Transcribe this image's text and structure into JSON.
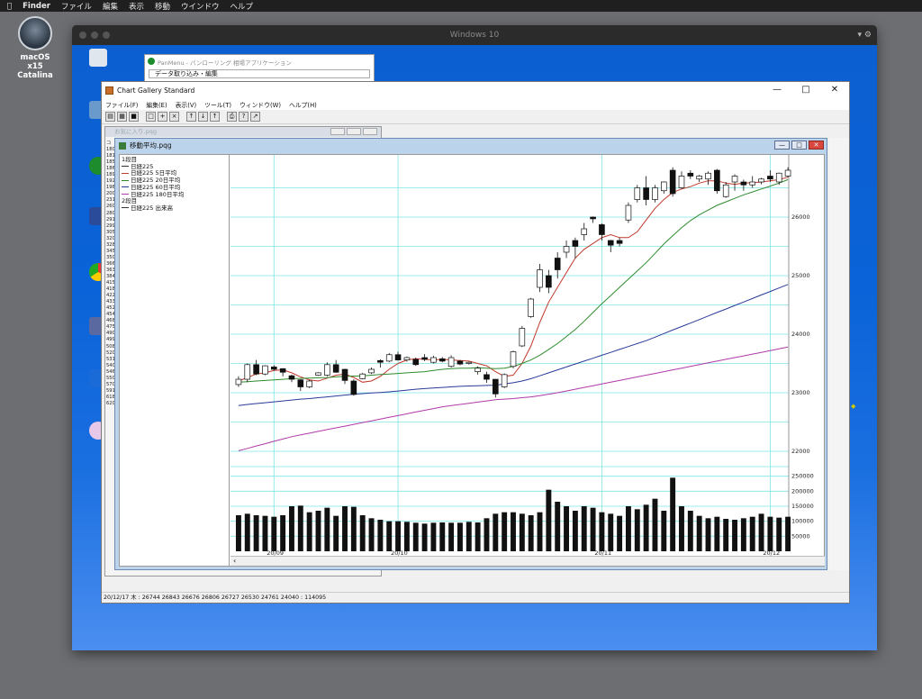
{
  "menubar": {
    "apple": "",
    "items": [
      "Finder",
      "ファイル",
      "編集",
      "表示",
      "移動",
      "ウインドウ",
      "ヘルプ"
    ]
  },
  "mac_desktop": {
    "disk_label_1": "macOS x15",
    "disk_label_2": "Catalina"
  },
  "vm": {
    "title": "Windows 10"
  },
  "panmenu": {
    "title": "PanMenu - パンローリング 相場アプリケーション",
    "row": "データ取り込み・編集"
  },
  "app": {
    "title": "Chart Gallery Standard",
    "menu": [
      "ファイル(F)",
      "編集(E)",
      "表示(V)",
      "ツール(T)",
      "ウィンドウ(W)",
      "ヘルプ(H)"
    ],
    "status": "20/12/17 木 : 26744 26843 26676 26806   26727 26530 24761 24040 : 114095"
  },
  "fav": {
    "title": "お気に入り.pqg",
    "codes": [
      "コ",
      "180",
      "181",
      "185",
      "186",
      "189",
      "192",
      "198",
      "200",
      "231",
      "260",
      "280",
      "291",
      "299",
      "305",
      "320",
      "328",
      "345",
      "350",
      "366",
      "363",
      "384",
      "415",
      "418",
      "422",
      "433",
      "452",
      "454",
      "468",
      "475",
      "490",
      "499",
      "508",
      "520",
      "531",
      "540",
      "546",
      "550",
      "570",
      "591",
      "618",
      "620"
    ]
  },
  "chartwin": {
    "title": "移動平均.pqg"
  },
  "legend": {
    "pane1": "1段目",
    "items": [
      {
        "label": "日経225",
        "color": "#333333"
      },
      {
        "label": "日経225 5日平均",
        "color": "#c0392b"
      },
      {
        "label": "日経225 20日平均",
        "color": "#2e8b2e"
      },
      {
        "label": "日経225 60日平均",
        "color": "#2a3a9a"
      },
      {
        "label": "日経225 180日平均",
        "color": "#b03aa8"
      }
    ],
    "pane2": "2段目",
    "volume_item": {
      "label": "日経225 出来高",
      "color": "#333333"
    }
  },
  "chart_data": {
    "type": "candlestick",
    "price_axis_ticks": [
      22000,
      23000,
      24000,
      25000,
      26000
    ],
    "volume_axis_ticks": [
      50000,
      100000,
      150000,
      200000,
      250000
    ],
    "x_tick_labels": [
      "20/09",
      "20/10",
      "20/11",
      "20/12"
    ],
    "candles": [
      {
        "o": 23140,
        "c": 23230,
        "h": 23280,
        "l": 23100
      },
      {
        "o": 23230,
        "c": 23480,
        "h": 23500,
        "l": 23180
      },
      {
        "o": 23480,
        "c": 23320,
        "h": 23560,
        "l": 23300
      },
      {
        "o": 23320,
        "c": 23460,
        "h": 23470,
        "l": 23300
      },
      {
        "o": 23440,
        "c": 23400,
        "h": 23470,
        "l": 23380
      },
      {
        "o": 23410,
        "c": 23350,
        "h": 23420,
        "l": 23280
      },
      {
        "o": 23290,
        "c": 23230,
        "h": 23310,
        "l": 23180
      },
      {
        "o": 23220,
        "c": 23100,
        "h": 23230,
        "l": 23030
      },
      {
        "o": 23100,
        "c": 23200,
        "h": 23220,
        "l": 23080
      },
      {
        "o": 23300,
        "c": 23340,
        "h": 23350,
        "l": 23290
      },
      {
        "o": 23300,
        "c": 23480,
        "h": 23520,
        "l": 23280
      },
      {
        "o": 23480,
        "c": 23350,
        "h": 23560,
        "l": 23340
      },
      {
        "o": 23400,
        "c": 23210,
        "h": 23410,
        "l": 23150
      },
      {
        "o": 23200,
        "c": 22970,
        "h": 23230,
        "l": 22950
      },
      {
        "o": 23240,
        "c": 23320,
        "h": 23340,
        "l": 23230
      },
      {
        "o": 23340,
        "c": 23400,
        "h": 23430,
        "l": 23320
      },
      {
        "o": 23550,
        "c": 23520,
        "h": 23570,
        "l": 23430
      },
      {
        "o": 23540,
        "c": 23650,
        "h": 23680,
        "l": 23520
      },
      {
        "o": 23650,
        "c": 23560,
        "h": 23700,
        "l": 23550
      },
      {
        "o": 23560,
        "c": 23600,
        "h": 23620,
        "l": 23530
      },
      {
        "o": 23570,
        "c": 23480,
        "h": 23600,
        "l": 23460
      },
      {
        "o": 23600,
        "c": 23570,
        "h": 23660,
        "l": 23540
      },
      {
        "o": 23520,
        "c": 23600,
        "h": 23630,
        "l": 23500
      },
      {
        "o": 23580,
        "c": 23540,
        "h": 23610,
        "l": 23520
      },
      {
        "o": 23450,
        "c": 23600,
        "h": 23640,
        "l": 23430
      },
      {
        "o": 23540,
        "c": 23490,
        "h": 23560,
        "l": 23470
      },
      {
        "o": 23500,
        "c": 23520,
        "h": 23530,
        "l": 23480
      },
      {
        "o": 23360,
        "c": 23420,
        "h": 23450,
        "l": 23310
      },
      {
        "o": 23310,
        "c": 23230,
        "h": 23360,
        "l": 23170
      },
      {
        "o": 23230,
        "c": 22980,
        "h": 23230,
        "l": 22920
      },
      {
        "o": 23100,
        "c": 23310,
        "h": 23330,
        "l": 23080
      },
      {
        "o": 23450,
        "c": 23700,
        "h": 23720,
        "l": 23420
      },
      {
        "o": 23800,
        "c": 24100,
        "h": 24140,
        "l": 23780
      },
      {
        "o": 24300,
        "c": 24600,
        "h": 24620,
        "l": 24280
      },
      {
        "o": 24800,
        "c": 25100,
        "h": 25200,
        "l": 24720
      },
      {
        "o": 25000,
        "c": 24800,
        "h": 25100,
        "l": 24700
      },
      {
        "o": 25300,
        "c": 25100,
        "h": 25400,
        "l": 24950
      },
      {
        "o": 25400,
        "c": 25500,
        "h": 25600,
        "l": 25300
      },
      {
        "o": 25600,
        "c": 25500,
        "h": 25650,
        "l": 25300
      },
      {
        "o": 25700,
        "c": 25800,
        "h": 25900,
        "l": 25600
      },
      {
        "o": 26000,
        "c": 25970,
        "h": 26010,
        "l": 25900
      },
      {
        "o": 25870,
        "c": 25700,
        "h": 25890,
        "l": 25600
      },
      {
        "o": 25600,
        "c": 25520,
        "h": 25610,
        "l": 25400
      },
      {
        "o": 25600,
        "c": 25550,
        "h": 25650,
        "l": 25500
      },
      {
        "o": 25950,
        "c": 26200,
        "h": 26250,
        "l": 25900
      },
      {
        "o": 26300,
        "c": 26500,
        "h": 26550,
        "l": 26250
      },
      {
        "o": 26500,
        "c": 26300,
        "h": 26700,
        "l": 26200
      },
      {
        "o": 26300,
        "c": 26500,
        "h": 26550,
        "l": 26250
      },
      {
        "o": 26450,
        "c": 26600,
        "h": 26610,
        "l": 26400
      },
      {
        "o": 26800,
        "c": 26400,
        "h": 26850,
        "l": 26350
      },
      {
        "o": 26500,
        "c": 26700,
        "h": 26780,
        "l": 26480
      },
      {
        "o": 26750,
        "c": 26700,
        "h": 26800,
        "l": 26650
      },
      {
        "o": 26650,
        "c": 26700,
        "h": 26720,
        "l": 26600
      },
      {
        "o": 26650,
        "c": 26750,
        "h": 26780,
        "l": 26550
      },
      {
        "o": 26800,
        "c": 26450,
        "h": 26820,
        "l": 26400
      },
      {
        "o": 26350,
        "c": 26550,
        "h": 26600,
        "l": 26330
      },
      {
        "o": 26600,
        "c": 26700,
        "h": 26730,
        "l": 26450
      },
      {
        "o": 26600,
        "c": 26550,
        "h": 26640,
        "l": 26450
      },
      {
        "o": 26550,
        "c": 26600,
        "h": 26700,
        "l": 26500
      },
      {
        "o": 26600,
        "c": 26650,
        "h": 26670,
        "l": 26560
      },
      {
        "o": 26700,
        "c": 26650,
        "h": 26800,
        "l": 26600
      },
      {
        "o": 26600,
        "c": 26750,
        "h": 26760,
        "l": 26550
      },
      {
        "o": 26700,
        "c": 26800,
        "h": 26850,
        "l": 26680
      }
    ],
    "ma": [
      {
        "name": "日経225 5日平均",
        "color": "#c0392b",
        "values": [
          23200,
          23260,
          23320,
          23340,
          23380,
          23390,
          23340,
          23270,
          23220,
          23200,
          23250,
          23300,
          23320,
          23260,
          23180,
          23200,
          23280,
          23400,
          23500,
          23560,
          23580,
          23570,
          23560,
          23570,
          23560,
          23550,
          23540,
          23500,
          23460,
          23360,
          23280,
          23300,
          23500,
          23800,
          24200,
          24550,
          24800,
          25050,
          25300,
          25450,
          25550,
          25650,
          25700,
          25650,
          25650,
          25750,
          25950,
          26150,
          26300,
          26420,
          26480,
          26520,
          26580,
          26620,
          26620,
          26580,
          26560,
          26580,
          26590,
          26600,
          26620,
          26640,
          26680
        ]
      },
      {
        "name": "日経225 20日平均",
        "color": "#2e8b2e",
        "values": [
          23180,
          23190,
          23200,
          23210,
          23220,
          23230,
          23240,
          23245,
          23250,
          23255,
          23260,
          23270,
          23280,
          23285,
          23290,
          23300,
          23310,
          23320,
          23330,
          23340,
          23350,
          23360,
          23380,
          23400,
          23410,
          23420,
          23420,
          23430,
          23420,
          23410,
          23420,
          23450,
          23500,
          23560,
          23640,
          23740,
          23840,
          23960,
          24080,
          24220,
          24370,
          24520,
          24660,
          24800,
          24940,
          25080,
          25220,
          25380,
          25540,
          25680,
          25820,
          25940,
          26040,
          26120,
          26200,
          26260,
          26320,
          26380,
          26430,
          26480,
          26530,
          26580,
          26640
        ]
      },
      {
        "name": "日経225 60日平均",
        "color": "#2a3a9a",
        "values": [
          22780,
          22800,
          22815,
          22830,
          22845,
          22860,
          22875,
          22890,
          22900,
          22915,
          22930,
          22945,
          22960,
          22975,
          22985,
          22995,
          23005,
          23015,
          23030,
          23045,
          23060,
          23070,
          23080,
          23090,
          23100,
          23110,
          23115,
          23120,
          23125,
          23130,
          23150,
          23170,
          23200,
          23240,
          23290,
          23340,
          23390,
          23440,
          23490,
          23540,
          23590,
          23640,
          23690,
          23740,
          23790,
          23840,
          23890,
          23950,
          24010,
          24070,
          24130,
          24190,
          24250,
          24310,
          24370,
          24430,
          24490,
          24550,
          24610,
          24670,
          24730,
          24790,
          24850
        ]
      },
      {
        "name": "日経225 180日平均",
        "color": "#b03aa8",
        "values": [
          22010,
          22050,
          22090,
          22130,
          22170,
          22210,
          22250,
          22280,
          22310,
          22340,
          22370,
          22400,
          22430,
          22460,
          22490,
          22520,
          22550,
          22580,
          22610,
          22640,
          22670,
          22700,
          22730,
          22760,
          22780,
          22800,
          22820,
          22840,
          22860,
          22880,
          22890,
          22900,
          22915,
          22930,
          22950,
          22975,
          23000,
          23030,
          23060,
          23090,
          23120,
          23150,
          23180,
          23210,
          23240,
          23270,
          23300,
          23330,
          23360,
          23390,
          23420,
          23450,
          23480,
          23510,
          23540,
          23570,
          23600,
          23630,
          23660,
          23690,
          23720,
          23750,
          23780
        ]
      }
    ],
    "volume": [
      120000,
      125000,
      120000,
      118000,
      115000,
      120000,
      150000,
      152000,
      130000,
      135000,
      145000,
      118000,
      150000,
      148000,
      120000,
      110000,
      105000,
      100000,
      100000,
      98000,
      95000,
      92000,
      95000,
      96000,
      95000,
      95000,
      98000,
      96000,
      110000,
      125000,
      130000,
      130000,
      125000,
      120000,
      130000,
      205000,
      165000,
      150000,
      135000,
      150000,
      145000,
      130000,
      125000,
      118000,
      150000,
      140000,
      155000,
      175000,
      135000,
      245000,
      150000,
      135000,
      118000,
      110000,
      115000,
      108000,
      105000,
      110000,
      115000,
      125000,
      115000,
      112000,
      115000
    ]
  }
}
